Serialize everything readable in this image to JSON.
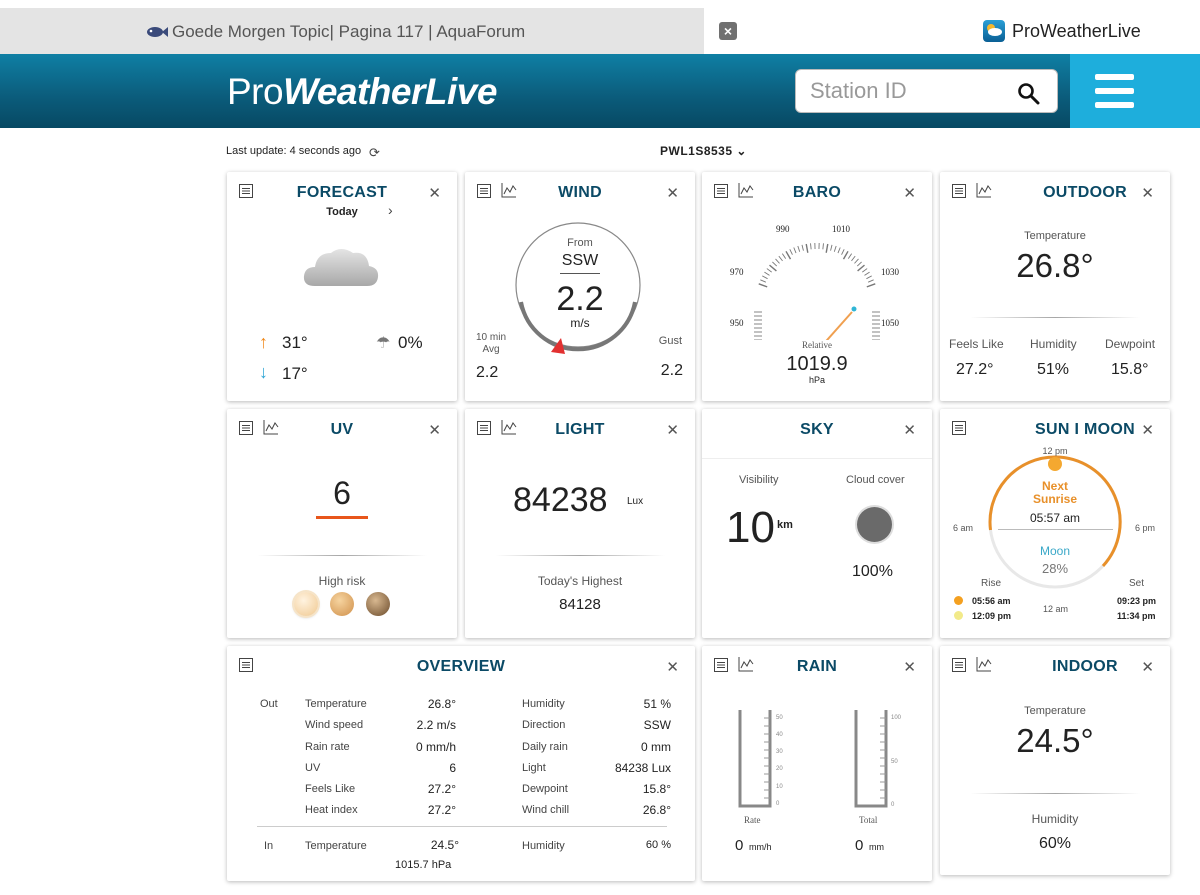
{
  "browser": {
    "inactive_tab_title": "Goede Morgen Topic| Pagina 117 | AquaForum",
    "close_tab_label": "×",
    "active_tab_title": "ProWeatherLive"
  },
  "header": {
    "logo_light": "Pro",
    "logo_bold": "WeatherLive",
    "search_placeholder": "Station ID"
  },
  "status": {
    "last_update": "Last update: 4 seconds ago",
    "station": "PWL1S8535"
  },
  "forecast": {
    "title": "FORECAST",
    "day": "Today",
    "high": "31°",
    "low": "17°",
    "precip": "0%"
  },
  "wind": {
    "title": "WIND",
    "from_label": "From",
    "direction": "SSW",
    "speed": "2.2",
    "unit": "m/s",
    "avg_label_1": "10 min",
    "avg_label_2": "Avg",
    "avg_value": "2.2",
    "gust_label": "Gust",
    "gust_value": "2.2"
  },
  "baro": {
    "title": "BARO",
    "ticks": [
      "950",
      "970",
      "990",
      "1010",
      "1030",
      "1050"
    ],
    "relative_label": "Relative",
    "value": "1019.9",
    "unit": "hPa"
  },
  "outdoor": {
    "title": "OUTDOOR",
    "temp_label": "Temperature",
    "temp": "26.8°",
    "feels_label": "Feels Like",
    "feels": "27.2°",
    "humidity_label": "Humidity",
    "humidity": "51%",
    "dewpoint_label": "Dewpoint",
    "dewpoint": "15.8°"
  },
  "uv": {
    "title": "UV",
    "value": "6",
    "risk": "High risk"
  },
  "light": {
    "title": "LIGHT",
    "value": "84238",
    "unit": "Lux",
    "highest_label": "Today's Highest",
    "highest": "84128"
  },
  "sky": {
    "title": "SKY",
    "visibility_label": "Visibility",
    "visibility": "10",
    "visibility_unit": "km",
    "cloud_label": "Cloud cover",
    "cloud": "100%"
  },
  "sunmoon": {
    "title": "SUN I MOON",
    "noon": "12 pm",
    "six_am": "6 am",
    "six_pm": "6 pm",
    "midnight": "12 am",
    "next_1": "Next",
    "next_2": "Sunrise",
    "next_time": "05:57 am",
    "moon_label": "Moon",
    "moon_pct": "28%",
    "rise_label": "Rise",
    "set_label": "Set",
    "sun_rise": "05:56 am",
    "sun_set": "09:23 pm",
    "moon_rise": "12:09 pm",
    "moon_set": "11:34 pm"
  },
  "overview": {
    "title": "OVERVIEW",
    "out_label": "Out",
    "in_label": "In",
    "rows": [
      {
        "l1": "Temperature",
        "v1": "26.8°",
        "l2": "Humidity",
        "v2": "51 %"
      },
      {
        "l1": "Wind speed",
        "v1": "2.2 m/s",
        "l2": "Direction",
        "v2": "SSW"
      },
      {
        "l1": "Rain rate",
        "v1": "0 mm/h",
        "l2": "Daily rain",
        "v2": "0 mm"
      },
      {
        "l1": "UV",
        "v1": "6",
        "l2": "Light",
        "v2": "84238 Lux"
      },
      {
        "l1": "Feels Like",
        "v1": "27.2°",
        "l2": "Dewpoint",
        "v2": "15.8°"
      },
      {
        "l1": "Heat index",
        "v1": "27.2°",
        "l2": "Wind chill",
        "v2": "26.8°"
      }
    ],
    "in_row": {
      "l1": "Temperature",
      "v1": "24.5°",
      "l2": "Humidity",
      "v2": "60 %"
    },
    "in_extra": "1015.7 hPa"
  },
  "rain": {
    "title": "RAIN",
    "rate_ticks": [
      "50",
      "40",
      "30",
      "20",
      "10",
      "0"
    ],
    "total_ticks": [
      "100",
      "50",
      "0"
    ],
    "rate_label": "Rate",
    "total_label": "Total",
    "rate_value": "0",
    "rate_unit": "mm/h",
    "total_value": "0",
    "total_unit": "mm"
  },
  "indoor": {
    "title": "INDOOR",
    "temp_label": "Temperature",
    "temp": "24.5°",
    "humidity_label": "Humidity",
    "humidity": "60%"
  },
  "colors": {
    "header_dark": "#074963",
    "menu_accent": "#1eaedc",
    "title_color": "#0b4a66",
    "uv_accent": "#e8561b",
    "sun_arc": "#e8902a",
    "moon_text": "#3aa8c8"
  }
}
